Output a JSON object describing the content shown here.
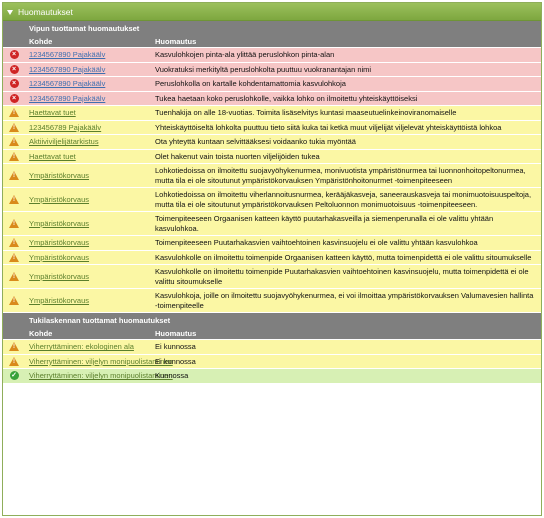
{
  "panel": {
    "title": "Huomautukset"
  },
  "vipu": {
    "title": "Vipun tuottamat huomautukset",
    "col_kohde": "Kohde",
    "col_huomautus": "Huomautus",
    "rows": [
      {
        "status": "error",
        "icon": "error-icon",
        "kohde": "1234567890 Pajakäälv",
        "msg": "Kasvulohkojen pinta-ala ylittää peruslohkon pinta-alan"
      },
      {
        "status": "error",
        "icon": "error-icon",
        "kohde": "1234567890 Pajakäälv",
        "msg": "Vuokratuksi merkityltä peruslohkolta puuttuu vuokranantajan nimi"
      },
      {
        "status": "error",
        "icon": "error-icon",
        "kohde": "1234567890 Pajakäälv",
        "msg": "Peruslohkolla on kartalle kohdentamattomia kasvulohkoja"
      },
      {
        "status": "error",
        "icon": "error-icon",
        "kohde": "1234567890 Pajakäälv",
        "msg": "Tukea haetaan koko peruslohkolle, vaikka lohko on ilmoitettu yhteiskäyttöiseksi"
      },
      {
        "status": "warning",
        "icon": "warning-icon",
        "kohde": "Haettavat tuet",
        "msg": "Tuenhakija on alle 18-vuotias. Toimita lisäselvitys kuntasi maaseutuelinkeinoviranomaiselle"
      },
      {
        "status": "warning",
        "icon": "warning-icon",
        "kohde": "123456789 Pajakäälv",
        "msg": "Yhteiskäyttöiseltä lohkolta puuttuu tieto siitä kuka tai ketkä muut viljelijät viljelevät yhteiskäyttöistä lohkoa"
      },
      {
        "status": "warning",
        "icon": "warning-icon",
        "kohde": "Aktiiviviljelijätarkistus",
        "msg": "Ota yhteyttä kuntaan selvittääksesi voidaanko tukia myöntää"
      },
      {
        "status": "warning",
        "icon": "warning-icon",
        "kohde": "Haettavat tuet",
        "msg": "Olet hakenut vain toista nuorten viljelijöiden tukea"
      },
      {
        "status": "warning",
        "icon": "warning-icon",
        "kohde": "Ympäristökorvaus",
        "msg": "Lohkotiedoissa on ilmoitettu suojavyöhykenurmea, monivuotista ympäristönurmea tai luonnonhoitopeltonurmea, mutta tila ei ole sitoutunut ympäristökorvauksen Ympäristönhoitonurmet -toimenpiteeseen"
      },
      {
        "status": "warning",
        "icon": "warning-icon",
        "kohde": "Ympäristökorvaus",
        "msg": "Lohkotiedoissa on ilmoitettu viherlannoitusnurmea, kerääjäkasveja, saneerauskasveja tai monimuotoisuuspeltoja, mutta tila ei ole sitoutunut ympäristökorvauksen Peltoluonnon monimuotoisuus -toimenpiteeseen."
      },
      {
        "status": "warning",
        "icon": "warning-icon",
        "kohde": "Ympäristökorvaus",
        "msg": "Toimenpiteeseen Orgaanisen katteen käyttö puutarhakasveilla ja siemenperunalla ei ole valittu yhtään kasvulohkoa."
      },
      {
        "status": "warning",
        "icon": "warning-icon",
        "kohde": "Ympäristökorvaus",
        "msg": "Toimenpiteeseen Puutarhakasvien vaihtoehtoinen kasvinsuojelu ei ole valittu yhtään kasvulohkoa"
      },
      {
        "status": "warning",
        "icon": "warning-icon",
        "kohde": "Ympäristökorvaus",
        "msg": "Kasvulohkolle on ilmoitettu toimenpide Orgaanisen katteen käyttö, mutta toimenpidettä ei ole valittu sitoumukselle"
      },
      {
        "status": "warning",
        "icon": "warning-icon",
        "kohde": "Ympäristökorvaus",
        "msg": "Kasvulohkolle on ilmoitettu toimenpide Puutarhakasvien vaihtoehtoinen kasvinsuojelu, mutta toimenpidettä ei ole valittu sitoumukselle"
      },
      {
        "status": "warning",
        "icon": "warning-icon",
        "kohde": "Ympäristökorvaus",
        "msg": "Kasvulohkoja, joille on ilmoitettu suojavyöhykenurmea, ei voi ilmoittaa ympäristökorvauksen Valumavesien hallinta -toimenpiteelle"
      }
    ]
  },
  "tukilaskenta": {
    "title": "Tukilaskennan tuottamat huomautukset",
    "col_kohde": "Kohde",
    "col_huomautus": "Huomautus",
    "rows": [
      {
        "status": "warning",
        "icon": "warning-icon",
        "kohde": "Viherryttäminen: ekologinen ala",
        "msg": "Ei kunnossa"
      },
      {
        "status": "warning",
        "icon": "warning-icon",
        "kohde": "Viherryttäminen: viljelyn monipuolistaminen",
        "msg": "Ei kunnossa"
      },
      {
        "status": "ok",
        "icon": "check-icon",
        "kohde": "Viherryttäminen: viljelyn monipuolistaminen",
        "msg": "Kunnossa"
      }
    ]
  }
}
